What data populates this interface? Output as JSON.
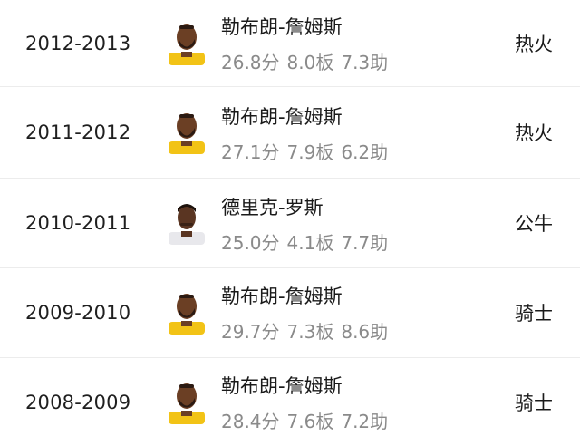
{
  "rows": [
    {
      "season": "2012-2013",
      "player": "勒布朗-詹姆斯",
      "points": "26.8分",
      "rebounds": "8.0板",
      "assists": "7.3助",
      "team": "热火",
      "avatar_icon": "player-avatar-lebron",
      "jersey_color": "#f2c316"
    },
    {
      "season": "2011-2012",
      "player": "勒布朗-詹姆斯",
      "points": "27.1分",
      "rebounds": "7.9板",
      "assists": "6.2助",
      "team": "热火",
      "avatar_icon": "player-avatar-lebron",
      "jersey_color": "#f2c316"
    },
    {
      "season": "2010-2011",
      "player": "德里克-罗斯",
      "points": "25.0分",
      "rebounds": "4.1板",
      "assists": "7.7助",
      "team": "公牛",
      "avatar_icon": "player-avatar-rose",
      "jersey_color": "#e8e8ec"
    },
    {
      "season": "2009-2010",
      "player": "勒布朗-詹姆斯",
      "points": "29.7分",
      "rebounds": "7.3板",
      "assists": "8.6助",
      "team": "骑士",
      "avatar_icon": "player-avatar-lebron",
      "jersey_color": "#f2c316"
    },
    {
      "season": "2008-2009",
      "player": "勒布朗-詹姆斯",
      "points": "28.4分",
      "rebounds": "7.6板",
      "assists": "7.2助",
      "team": "骑士",
      "avatar_icon": "player-avatar-lebron",
      "jersey_color": "#f2c316"
    }
  ]
}
